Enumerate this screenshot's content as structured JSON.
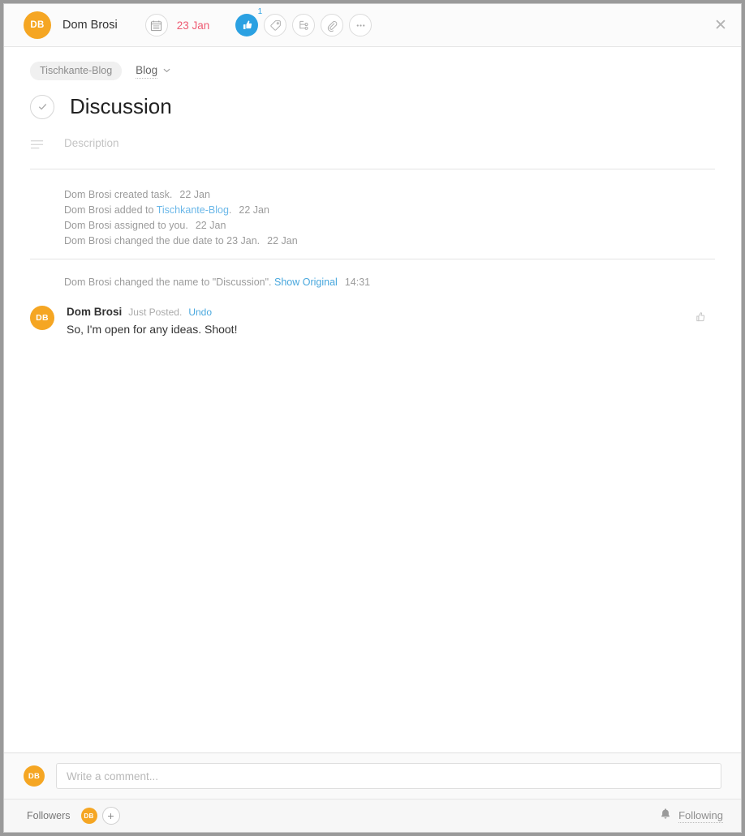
{
  "header": {
    "assignee": {
      "initials": "DB",
      "name": "Dom Brosi"
    },
    "calendar_icon": "calendar-icon",
    "due_date": "23 Jan",
    "like": {
      "icon": "thumbs-up-icon",
      "count": "1"
    },
    "actions": [
      {
        "icon": "tag-icon",
        "name": "tag-button"
      },
      {
        "icon": "subtask-icon",
        "name": "subtask-button"
      },
      {
        "icon": "attachment-icon",
        "name": "attachment-button"
      },
      {
        "icon": "more-icon",
        "name": "more-button"
      }
    ],
    "close_icon": "✕"
  },
  "task": {
    "project_pill": "Tischkante-Blog",
    "section": "Blog",
    "section_chevron": "⌄",
    "title": "Discussion",
    "complete_icon": "check-icon",
    "description_placeholder": "Description"
  },
  "activity": [
    {
      "text": "Dom Brosi created task.",
      "link": "",
      "suffix": "",
      "when": "22 Jan"
    },
    {
      "text": "Dom Brosi added to ",
      "link": "Tischkante-Blog",
      "suffix": ".",
      "when": "22 Jan"
    },
    {
      "text": "Dom Brosi assigned to you.",
      "link": "",
      "suffix": "",
      "when": "22 Jan"
    },
    {
      "text": "Dom Brosi changed the due date to 23 Jan.",
      "link": "",
      "suffix": "",
      "when": "22 Jan"
    }
  ],
  "rename_event": {
    "text": "Dom Brosi changed the name to \"Discussion\".",
    "link": "Show Original",
    "when": "14:31"
  },
  "comment": {
    "avatar_initials": "DB",
    "author": "Dom Brosi",
    "meta": "Just Posted.",
    "undo": "Undo",
    "text": "So, I'm open for any ideas. Shoot!",
    "like_icon": "thumbs-up-outline-icon"
  },
  "footer": {
    "avatar_initials": "DB",
    "comment_placeholder": "Write a comment...",
    "comment_value": "",
    "followers_label": "Followers",
    "follower_initials": "DB",
    "add_follower_icon": "+",
    "bell_icon": "bell-icon",
    "following_label": "Following"
  },
  "colors": {
    "avatar_orange": "#f5a623",
    "due_red": "#ee5a72",
    "like_blue": "#2ba1e2",
    "link_blue": "#4aa8de"
  }
}
